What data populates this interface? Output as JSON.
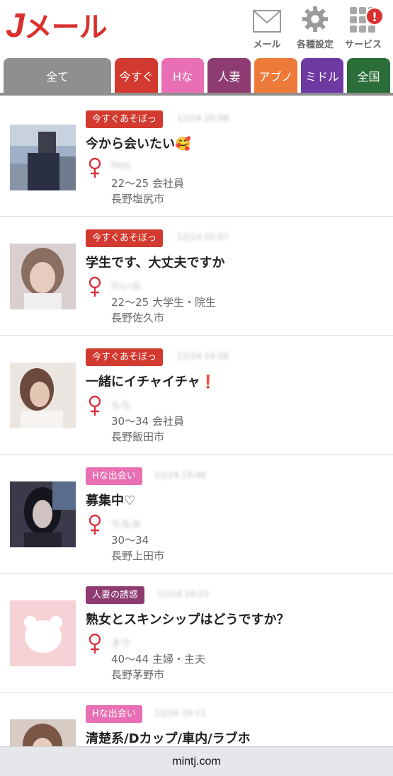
{
  "header": {
    "logo_main": "J",
    "logo_rest": "メール",
    "icons": [
      {
        "label": "メール",
        "icon": "mail-icon"
      },
      {
        "label": "各種設定",
        "icon": "gear-icon"
      },
      {
        "label": "サービス",
        "icon": "grid-icon",
        "badge": "!"
      }
    ]
  },
  "tabs": [
    {
      "label": "全て",
      "color": "#8f8f8f",
      "active": true
    },
    {
      "label": "今すぐ",
      "color": "#d33a2f"
    },
    {
      "label": "Hな",
      "color": "#e86fb3"
    },
    {
      "label": "人妻",
      "color": "#8e3b71"
    },
    {
      "label": "アブノ",
      "color": "#ee7a3a"
    },
    {
      "label": "ミドル",
      "color": "#6e3aa1"
    },
    {
      "label": "全国",
      "color": "#2b6e39"
    }
  ],
  "posts": [
    {
      "tag": "今すぐあそぼっ",
      "tag_color": "#d33a2f",
      "time": "12/24 20:08",
      "title": "今から会いたい🥰",
      "nickname": "hiro",
      "info": "22〜25 会社員",
      "location": "長野塩尻市"
    },
    {
      "tag": "今すぐあそぼっ",
      "tag_color": "#d33a2f",
      "time": "12/24 20:07",
      "title": "学生です、大丈夫ですか",
      "nickname": "れいみ",
      "info": "22〜25 大学生・院生",
      "location": "長野佐久市"
    },
    {
      "tag": "今すぐあそぼっ",
      "tag_color": "#d33a2f",
      "time": "12/24 19:58",
      "title": "一緒にイチャイチャ❗️",
      "nickname": "もち",
      "info": "30〜34 会社員",
      "location": "長野飯田市"
    },
    {
      "tag": "Hな出会い",
      "tag_color": "#e86fb3",
      "time": "12/24 19:46",
      "title": "募集中♡",
      "nickname": "ちなみ",
      "info": "30〜34",
      "location": "長野上田市"
    },
    {
      "tag": "人妻の誘惑",
      "tag_color": "#8e3b71",
      "time": "12/24 19:23",
      "title": "熟女とスキンシップはどうですか？",
      "nickname": "まり",
      "info": "40〜44 主婦・主夫",
      "location": "長野茅野市"
    },
    {
      "tag": "Hな出会い",
      "tag_color": "#e86fb3",
      "time": "12/24 19:11",
      "title": "清楚系/Dカップ/車内/ラブホ",
      "nickname": "",
      "info": "",
      "location": ""
    }
  ],
  "browser": {
    "url": "mintj.com"
  },
  "colors": {
    "brand": "#d9312f",
    "female_symbol": "#d9313e"
  }
}
